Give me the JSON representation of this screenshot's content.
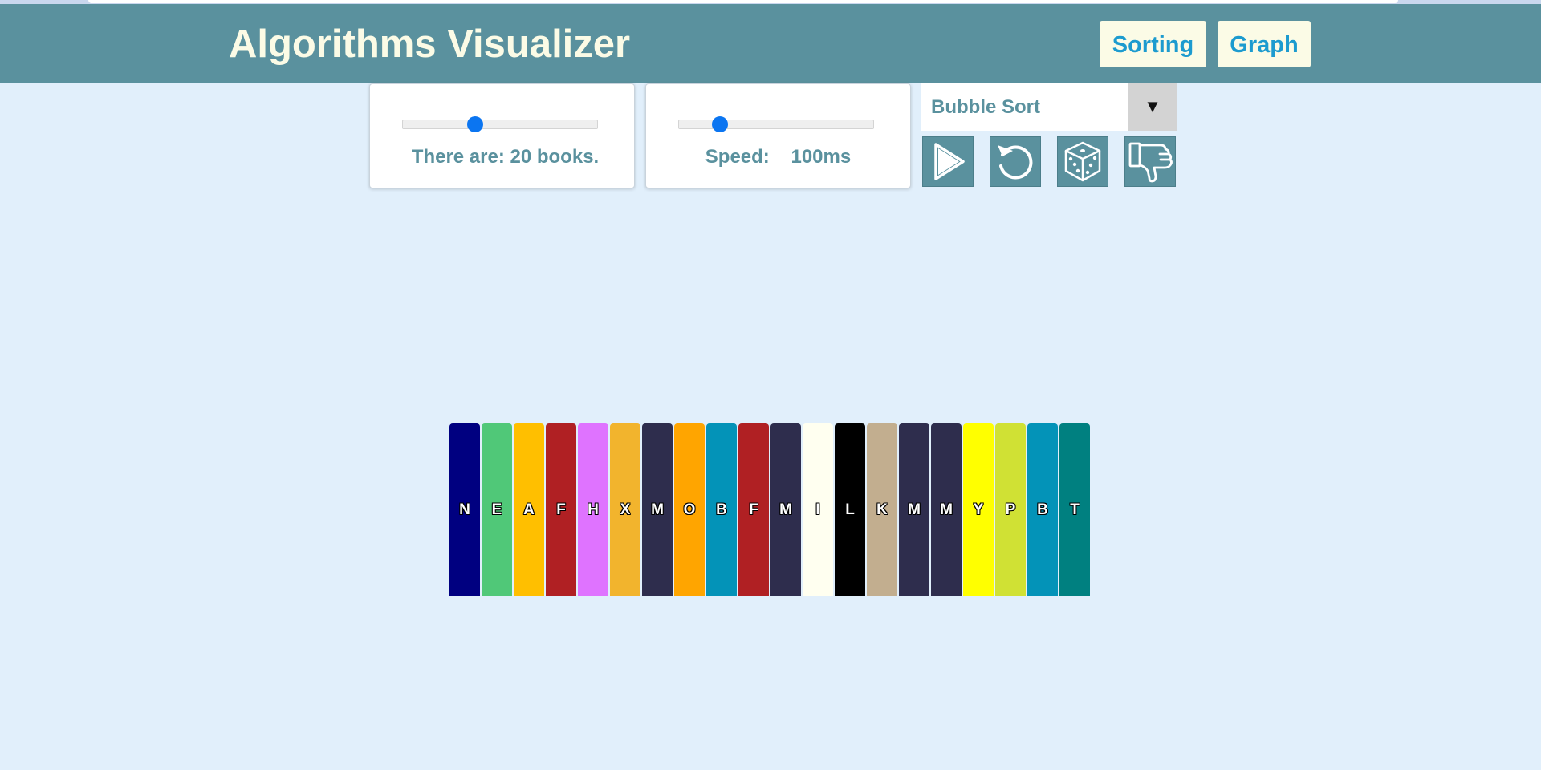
{
  "header": {
    "title": "Algorithms Visualizer",
    "nav": {
      "sorting_label": "Sorting",
      "graph_label": "Graph"
    }
  },
  "controls": {
    "count": {
      "label": "There are: 20 books.",
      "slider_fraction": 0.37
    },
    "speed": {
      "label": "Speed:    100ms",
      "slider_fraction": 0.21
    },
    "algorithm": {
      "selected": "Bubble Sort",
      "arrow": "▼"
    },
    "buttons": [
      {
        "name": "play-button",
        "icon": "play-icon"
      },
      {
        "name": "reset-button",
        "icon": "reset-icon"
      },
      {
        "name": "randomize-button",
        "icon": "dice-icon"
      },
      {
        "name": "worst-case-button",
        "icon": "thumbs-down-icon"
      }
    ]
  },
  "colors": {
    "header_bg": "#5a919e",
    "title_text": "#fbfbe6",
    "nav_text": "#1c9bcf",
    "page_bg": "#e1effb",
    "slider_thumb": "#0b75f1"
  },
  "books": [
    {
      "letter": "N",
      "color": "#000080"
    },
    {
      "letter": "E",
      "color": "#50c878"
    },
    {
      "letter": "A",
      "color": "#ffbf00"
    },
    {
      "letter": "F",
      "color": "#b02023"
    },
    {
      "letter": "H",
      "color": "#df73ff"
    },
    {
      "letter": "X",
      "color": "#f2b42d"
    },
    {
      "letter": "M",
      "color": "#2e2d4d"
    },
    {
      "letter": "O",
      "color": "#ffa500"
    },
    {
      "letter": "B",
      "color": "#0393b8"
    },
    {
      "letter": "F",
      "color": "#b02023"
    },
    {
      "letter": "M",
      "color": "#2e2d4d"
    },
    {
      "letter": "I",
      "color": "#fffff0"
    },
    {
      "letter": "L",
      "color": "#000000"
    },
    {
      "letter": "K",
      "color": "#c2ae8f"
    },
    {
      "letter": "M",
      "color": "#2e2d4d"
    },
    {
      "letter": "M",
      "color": "#2e2d4d"
    },
    {
      "letter": "Y",
      "color": "#ffff00"
    },
    {
      "letter": "P",
      "color": "#d0e134"
    },
    {
      "letter": "B",
      "color": "#0393b8"
    },
    {
      "letter": "T",
      "color": "#008080"
    }
  ]
}
